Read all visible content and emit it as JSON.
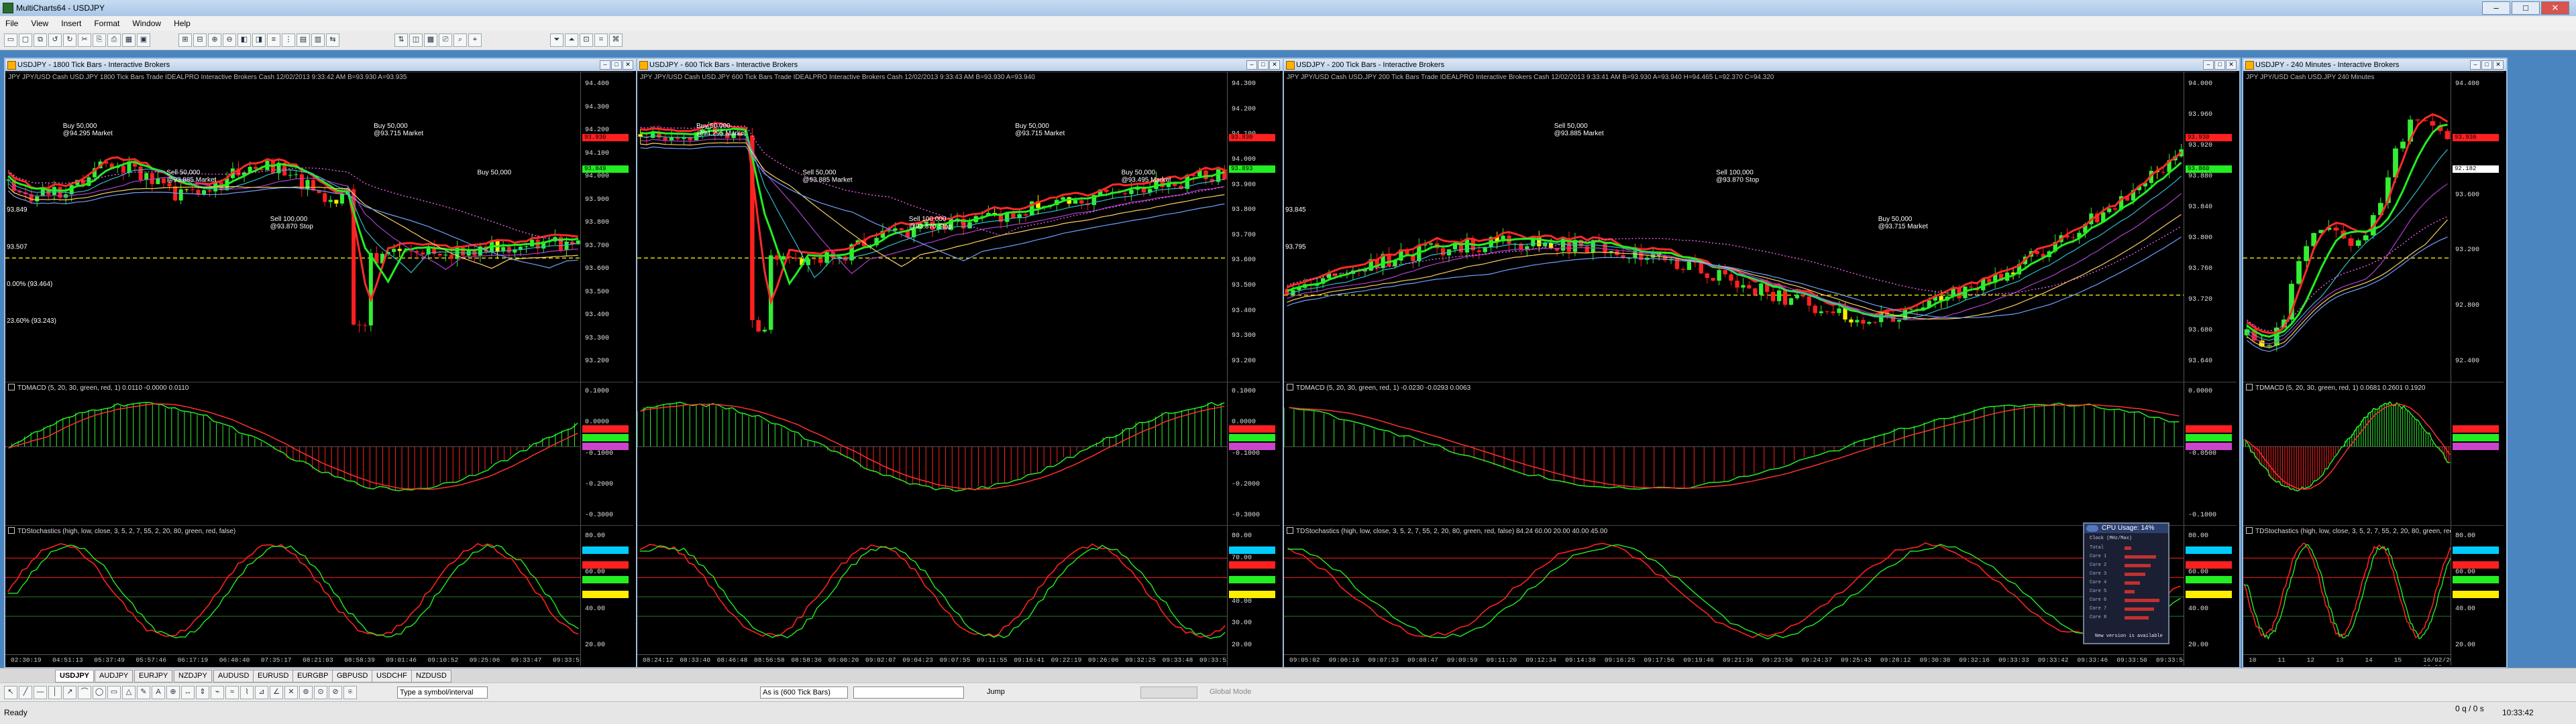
{
  "app": {
    "title": "MultiCharts64 - USDJPY",
    "menu": [
      "File",
      "View",
      "Insert",
      "Format",
      "Window",
      "Help"
    ]
  },
  "colors": {
    "up": "#33ee33",
    "down": "#ff2020",
    "accent_bg": "#000000",
    "ma_red": "#ff0000",
    "ma_green": "#22ee22",
    "dotted_yellow": "#dddd00"
  },
  "windows": [
    {
      "id": "w1",
      "title": "USDJPY - 1800 Tick Bars - Interactive Brokers",
      "header": "JPY JPY/USD Cash USD.JPY  1800 Tick Bars   Trade  IDEALPRO  Interactive Brokers  Cash  12/02/2013  9:33:42 AM  B=93.930  A=93.935",
      "price_labels": [
        "94.400",
        "94.300",
        "94.200",
        "94.100",
        "94.000",
        "93.900",
        "93.800",
        "93.700",
        "93.600",
        "93.500",
        "93.400",
        "93.300",
        "93.200"
      ],
      "badges": [
        {
          "text": "93.930",
          "color": "#ff2020"
        },
        {
          "text": "93.849",
          "color": "#22ee22"
        }
      ],
      "left_tags": [
        "93.849",
        "93.507",
        "0.00% (93.464)",
        "23.60% (93.243)"
      ],
      "trades": [
        {
          "text": "Buy 50,000",
          "sub": "@94.295 Market"
        },
        {
          "text": "Sell 50,000",
          "sub": "@93.885 Market"
        },
        {
          "text": "Sell 100,000",
          "sub": "@93.870 Stop"
        },
        {
          "text": "Buy 50,000",
          "sub": "@93.715 Market"
        },
        {
          "text": "Buy 50,000",
          "sub": ""
        }
      ],
      "macd_label": "TDMACD (5, 20, 30, green, red, 1)  0.0110  -0.0000  0.0110",
      "macd_axis": [
        "0.1000",
        "0.0000",
        "-0.1000",
        "-0.2000",
        "-0.3000"
      ],
      "stoch_label": "TDStochastics (high, low, close, 3, 5, 2, 7, 55, 2, 20, 80, green, red, false)",
      "stoch_axis": [
        "80.00",
        "60.00",
        "40.00",
        "20.00"
      ],
      "times": [
        "02:30:19",
        "04:51:13",
        "05:37:49",
        "05:57:46",
        "06:17:19",
        "06:40:40",
        "07:35:17",
        "08:21:03",
        "08:58:39",
        "09:01:46",
        "09:10:52",
        "09:25:06",
        "09:33:47",
        "09:33:51"
      ]
    },
    {
      "id": "w2",
      "title": "USDJPY - 600 Tick Bars - Interactive Brokers",
      "header": "JPY JPY/USD Cash USD.JPY  600 Tick Bars   Trade  IDEALPRO  Interactive Brokers  Cash  12/02/2013  9:33:43 AM  B=93.930  A=93.940",
      "price_labels": [
        "94.300",
        "94.200",
        "94.100",
        "94.000",
        "93.900",
        "93.800",
        "93.700",
        "93.600",
        "93.500",
        "93.400",
        "93.300",
        "93.200"
      ],
      "badges": [
        {
          "text": "93.930",
          "color": "#ff2020"
        },
        {
          "text": "93.893",
          "color": "#22ee22"
        }
      ],
      "trades": [
        {
          "text": "Buy 50,000",
          "sub": "@94.295 Market"
        },
        {
          "text": "Sell 50,000",
          "sub": "@93.885 Market"
        },
        {
          "text": "Sell 100,000",
          "sub": "@93.870 Stop"
        },
        {
          "text": "Buy 50,000",
          "sub": "@93.715 Market"
        },
        {
          "text": "Buy 50,000",
          "sub": "@93.495 Market"
        }
      ],
      "macd_axis": [
        "0.1000",
        "0.0000",
        "-0.1000",
        "-0.2000",
        "-0.3000"
      ],
      "stoch_axis": [
        "80.00",
        "70.00",
        "60.00",
        "40.00",
        "30.00",
        "20.00"
      ],
      "times": [
        "08:24:12",
        "08:33:40",
        "08:46:48",
        "08:56:58",
        "08:58:36",
        "09:00:20",
        "09:02:07",
        "09:04:23",
        "09:07:55",
        "09:11:55",
        "09:16:41",
        "09:22:19",
        "09:26:06",
        "09:32:25",
        "09:33:48",
        "09:33:52"
      ]
    },
    {
      "id": "w3",
      "title": "USDJPY - 200 Tick Bars - Interactive Brokers",
      "header": "JPY JPY/USD Cash USD.JPY  200 Tick Bars   Trade  IDEALPRO  Interactive Brokers  Cash  12/02/2013  9:33:41 AM  B=93.930  A=93.940  H=94.465  L=92.370  C=94.320",
      "price_labels": [
        "94.000",
        "93.960",
        "93.920",
        "93.880",
        "93.840",
        "93.800",
        "93.760",
        "93.720",
        "93.680",
        "93.640"
      ],
      "left_tags": [
        "93.845",
        "93.795"
      ],
      "badges": [
        {
          "text": "93.930",
          "color": "#ff2020"
        },
        {
          "text": "93.860",
          "color": "#22ee22"
        }
      ],
      "trades": [
        {
          "text": "Sell 50,000",
          "sub": "@93.885 Market"
        },
        {
          "text": "Sell 100,000",
          "sub": "@93.870 Stop"
        },
        {
          "text": "Buy 50,000",
          "sub": "@93.715 Market"
        }
      ],
      "macd_label": "TDMACD (5, 20, 30, green, red, 1)  -0.0230  -0.0293  0.0063",
      "macd_axis": [
        "0.0000",
        "-0.0500",
        "-0.1000"
      ],
      "stoch_label": "TDStochastics (high, low, close, 3, 5, 2, 7, 55, 2, 20, 80, green, red, false)  84.24  60.00  20.00  40.00  45.00",
      "stoch_axis": [
        "80.00",
        "60.00",
        "40.00",
        "20.00"
      ],
      "times": [
        "09:05:02",
        "09:06:16",
        "09:07:33",
        "09:08:47",
        "09:09:59",
        "09:11:20",
        "09:12:34",
        "09:14:38",
        "09:16:25",
        "09:17:56",
        "09:19:46",
        "09:21:36",
        "09:23:50",
        "09:24:37",
        "09:25:43",
        "09:28:12",
        "09:30:30",
        "09:32:16",
        "09:33:33",
        "09:33:42",
        "09:33:46",
        "09:33:50",
        "09:33:54"
      ]
    },
    {
      "id": "w4",
      "title": "USDJPY - 240 Minutes - Interactive Brokers",
      "header": "JPY JPY/USD Cash USD.JPY  240 Minutes",
      "price_labels": [
        "94.400",
        "94.000",
        "93.600",
        "93.200",
        "92.800",
        "92.400"
      ],
      "badges": [
        {
          "text": "93.930",
          "color": "#ff2020"
        },
        {
          "text": "92.182",
          "color": "#ffffff"
        }
      ],
      "macd_label": "TDMACD (5, 20, 30, green, red, 1)  0.0681  0.2601  0.1920",
      "stoch_label": "TDStochastics (high, low, close, 3, 5, 2, 7, 55, 2, 20, 80, green, red, false)",
      "stoch_axis": [
        "80.00",
        "60.00",
        "40.00",
        "20.00"
      ],
      "times": [
        "10",
        "11",
        "12",
        "13",
        "14",
        "15",
        "16/02/2013 08:00"
      ]
    }
  ],
  "symbol_tabs": [
    "USDJPY",
    "AUDJPY",
    "EURJPY",
    "NZDJPY",
    "AUDUSD",
    "EURUSD",
    "EURGBP",
    "GBPUSD",
    "USDCHF",
    "NZDUSD"
  ],
  "drawbar": {
    "symbol_placeholder": "Type a symbol/interval",
    "resolution": "As is (600 Tick Bars)",
    "jump_label": "Jump",
    "global_mode": "Global Mode"
  },
  "status": {
    "left": "Ready",
    "right_q": "0 q / 0 s",
    "time": "10:33:42"
  },
  "cpu_widget": {
    "title": "CPU Usage: 14%",
    "subtitle": "Clock (MHz/Max)",
    "rows": [
      "Total",
      "Core 1",
      "Core 2",
      "Core 3",
      "Core 4",
      "Core 5",
      "Core 6",
      "Core 7",
      "Core 8"
    ],
    "footer": "New version is available"
  }
}
